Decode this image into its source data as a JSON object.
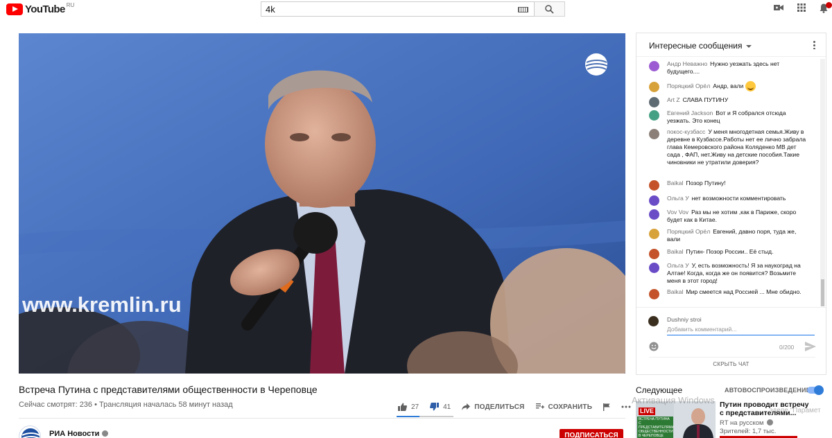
{
  "masthead": {
    "logo_text": "YouTube",
    "region": "RU",
    "search_value": "4k",
    "icons": [
      "youtube-logo-icon",
      "keyboard-icon",
      "search-icon",
      "create-video-icon",
      "apps-grid-icon",
      "notifications-bell-icon"
    ]
  },
  "video": {
    "title": "Встреча Путина с представителями общественности в Череповце",
    "meta": "Сейчас смотрят: 236 • Трансляция началась 58 минут назад",
    "likes": "27",
    "dislikes": "41",
    "like_ratio": 0.4,
    "share_label": "Поделиться",
    "save_label": "Сохранить",
    "overlay_text": "www.kremlin.ru"
  },
  "channel": {
    "name": "РИА Новости",
    "subscribe_label": "Подписаться"
  },
  "chat": {
    "header": "Интересные сообщения",
    "messages": [
      {
        "author": "Андр Неважно",
        "text": "Нужно уезжать здесь нет будущего....",
        "color": "#9c5bd3"
      },
      {
        "author": "Поряцкий Орёл",
        "text": "Андр, вали",
        "color": "#d8a23a"
      },
      {
        "author": "Art Z",
        "text": "СЛАВА ПУТИНУ",
        "color": "#5f6b73"
      },
      {
        "author": "Евгений Jackson",
        "text": "Вот и Я собрался отсюда уезжать. Это конец",
        "color": "#45a184"
      },
      {
        "author": "покос-кузбасс",
        "text": "У меня многодетная семья.Живу в деревне в Кузбассе.Работы нет ее лично забрала глава Кемеровского района Коляденко МВ дет сада , ФАП, нет.Живу на детские пособия.Такие чиновники не утратили доверия?",
        "color": "#8c7f78"
      },
      {
        "author": "Baikal",
        "text": "Позор Путину!",
        "color": "#c4522a"
      },
      {
        "author": "Ольга У",
        "text": "нет возможности комментировать",
        "color": "#6a4cc7"
      },
      {
        "author": "Vov Vov",
        "text": "Раз мы не хотим ,как в Париже, скоро будет как в Китае.",
        "color": "#6a4cc7"
      },
      {
        "author": "Поряцкий Орёл",
        "text": "Евгений, давно поря, туда же, вали",
        "color": "#d8a23a"
      },
      {
        "author": "Baikal",
        "text": "Путин- Позор России.. Её стыд.",
        "color": "#c4522a"
      },
      {
        "author": "Ольга У",
        "text": "У, есть возможность! Я за наукоград на Алтае! Когда, когда же он появится? Возьмите меня в этот город!",
        "color": "#6a4cc7"
      },
      {
        "author": "Baikal",
        "text": "Мир смеется над Россией ... Мне обидно.",
        "color": "#c4522a"
      }
    ],
    "input": {
      "user": "Dushniy stroi",
      "placeholder": "Добавить комментарий...",
      "counter": "0/200",
      "hide_label": "Скрыть чат"
    }
  },
  "upnext": {
    "label": "Следующее",
    "autoplay_label": "Автовоспроизведение",
    "autoplay_on": true,
    "item": {
      "badge": "LIVE",
      "thumb_caption": "ВСТРЕЧА ПУТИНА С ПРЕДСТАВИТЕЛЯМИ ОБЩЕСТВЕННОСТИ В ЧЕРЕПОВЦЕ",
      "title": "Путин проводит встречу с представителями...",
      "channel": "RT на русском",
      "views": "Зрителей: 1,7 тыс."
    }
  },
  "os_watermark": {
    "line1": "Активация Windows",
    "line2": "зделе \"Парамет"
  }
}
